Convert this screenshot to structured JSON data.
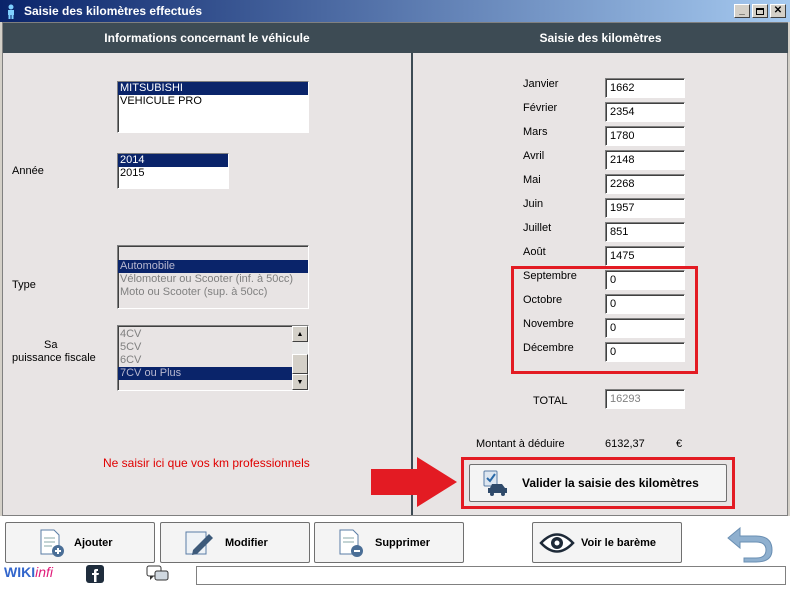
{
  "window": {
    "title": "Saisie des kilomètres effectués"
  },
  "left_panel": {
    "header": "Informations concernant le véhicule",
    "vehicle_list": [
      "MITSUBISHI",
      "VEHICULE PRO"
    ],
    "vehicle_selected_index": 0,
    "annee_label": "Année",
    "annee_list": [
      "2014",
      "2015"
    ],
    "annee_selected_index": 0,
    "type_label": "Type",
    "type_list": [
      "Automobile",
      "Vélomoteur ou Scooter (inf. à 50cc)",
      "Moto ou Scooter  (sup. à 50cc)"
    ],
    "type_selected_index": 0,
    "puissance_label_1": "Sa",
    "puissance_label_2": "puissance fiscale",
    "puissance_list": [
      "4CV",
      "5CV",
      "6CV",
      "7CV ou Plus"
    ],
    "puissance_selected_index": 3,
    "note": "Ne saisir ici que vos km professionnels"
  },
  "right_panel": {
    "header": "Saisie des kilomètres",
    "months": [
      {
        "label": "Janvier",
        "value": "1662"
      },
      {
        "label": "Février",
        "value": "2354"
      },
      {
        "label": "Mars",
        "value": "1780"
      },
      {
        "label": "Avril",
        "value": "2148"
      },
      {
        "label": "Mai",
        "value": "2268"
      },
      {
        "label": "Juin",
        "value": "1957"
      },
      {
        "label": "Juillet",
        "value": "851"
      },
      {
        "label": "Août",
        "value": "1475"
      },
      {
        "label": "Septembre",
        "value": "0"
      },
      {
        "label": "Octobre",
        "value": "0"
      },
      {
        "label": "Novembre",
        "value": "0"
      },
      {
        "label": "Décembre",
        "value": "0"
      }
    ],
    "total_label": "TOTAL",
    "total_value": "16293",
    "montant_label": "Montant à déduire",
    "montant_value": "6132,37",
    "currency": "€",
    "validate_label": "Valider la saisie des kilomètres"
  },
  "toolbar": {
    "add_label": "Ajouter",
    "edit_label": "Modifier",
    "delete_label": "Supprimer",
    "bareme_label": "Voir le barème"
  },
  "footer": {
    "brand_1": "WIKI",
    "brand_2": "infi"
  },
  "colors": {
    "header_bg": "#3d4b54",
    "highlight_red": "#e31b23",
    "selection": "#0a246a"
  }
}
